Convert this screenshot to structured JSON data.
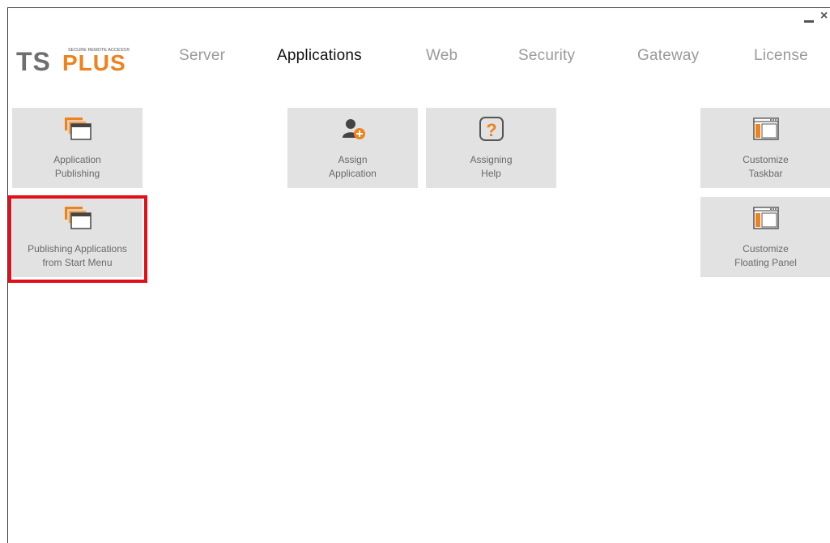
{
  "window": {
    "minimize_label": "_",
    "close_label": "×"
  },
  "brand": {
    "tagline": "SECURE REMOTE ACCESS®",
    "name_part1": "TS",
    "name_part2": "PLUS",
    "accent_color": "#f0821e"
  },
  "nav": {
    "tabs": [
      {
        "label": "Server"
      },
      {
        "label": "Applications"
      },
      {
        "label": "Web"
      },
      {
        "label": "Security"
      },
      {
        "label": "Gateway"
      },
      {
        "label": "License"
      }
    ],
    "active": "Applications"
  },
  "tiles": {
    "app_publishing": {
      "line1": "Application",
      "line2": "Publishing",
      "icon": "stacked-windows-icon"
    },
    "start_menu": {
      "line1": "Publishing Applications",
      "line2": "from Start Menu",
      "icon": "stacked-windows-icon",
      "highlighted": true
    },
    "assign_app": {
      "line1": "Assign",
      "line2": "Application",
      "icon": "user-add-icon"
    },
    "assigning_help": {
      "line1": "Assigning",
      "line2": "Help",
      "icon": "question-mark-icon"
    },
    "customize_taskbar": {
      "line1": "Customize",
      "line2": "Taskbar",
      "icon": "window-panel-icon"
    },
    "customize_floating": {
      "line1": "Customize",
      "line2": "Floating Panel",
      "icon": "window-panel-icon"
    }
  }
}
